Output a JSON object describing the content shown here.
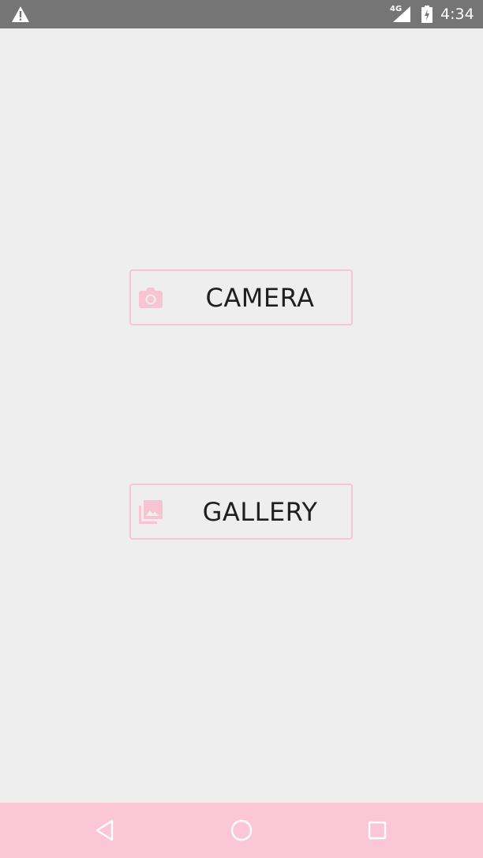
{
  "status_bar": {
    "network": "4G",
    "time": "4:34",
    "icons": [
      "warning-icon",
      "signal-icon",
      "battery-charging-icon"
    ]
  },
  "buttons": {
    "camera": {
      "label": "CAMERA",
      "icon": "camera-icon"
    },
    "gallery": {
      "label": "GALLERY",
      "icon": "photo-library-icon"
    }
  },
  "nav_bar": {
    "icons": [
      "back-icon",
      "home-icon",
      "recents-icon"
    ]
  },
  "colors": {
    "status_bar_bg": "#757575",
    "background": "#eeeeee",
    "accent_pink": "#f8c3d2",
    "nav_bar_bg": "#fbc6d5",
    "label_text": "#1f1f1f"
  }
}
